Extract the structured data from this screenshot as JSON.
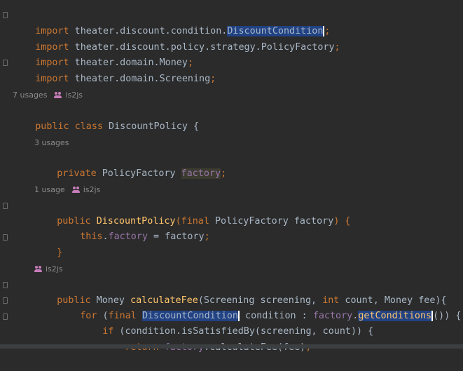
{
  "code": {
    "line1": {
      "kw": "import",
      "path": " theater.discount.condition.",
      "cls": "DiscountCondition",
      "semi": ";"
    },
    "line2": {
      "kw": "import",
      "rest": " theater.discount.policy.strategy.PolicyFactory",
      "semi": ";"
    },
    "line3": {
      "kw": "import",
      "rest": " theater.domain.Money",
      "semi": ";"
    },
    "line4": {
      "kw": "import",
      "rest": " theater.domain.Screening",
      "semi": ";"
    },
    "hint_class": {
      "usages": "7 usages",
      "author": "is2js"
    },
    "class_decl": {
      "kw1": "public",
      "kw2": " class",
      "name": " DiscountPolicy {",
      "tail": ""
    },
    "hint_field": {
      "usages": "3 usages"
    },
    "field_decl": {
      "kw": "private",
      "type": " PolicyFactory ",
      "name": "factory",
      "semi": ";"
    },
    "hint_ctor": {
      "usages": "1 usage",
      "author": "is2js"
    },
    "ctor_decl": {
      "kw": "public",
      "name": "DiscountPolicy",
      "open": "(",
      "kw2": "final",
      "params": " PolicyFactory factory",
      "close": ") {"
    },
    "ctor_body": {
      "kw": "this",
      "dot": ".",
      "fld": "factory",
      "rest": " = factory",
      "semi": ";"
    },
    "ctor_close": "}",
    "hint_method": {
      "author": "is2js"
    },
    "method_decl": {
      "kw": "public",
      "p1": " Money ",
      "name": "calculateFee",
      "p2": "(Screening screening, ",
      "kw2": "int",
      "p3": " count, Money fee){"
    },
    "for_line": {
      "kw": "for",
      "p1": " (",
      "kw2": "final",
      "p2": " ",
      "cls": "DiscountCondition",
      "p3": " condition : ",
      "fld": "factory",
      "dot": ".",
      "call": "getConditions",
      "p4": "()) {"
    },
    "if_line": {
      "kw": "if",
      "rest": " (condition.isSatisfiedBy(screening, count)) {"
    },
    "return_line": {
      "kw": "return",
      "p1": " ",
      "fld": "factory",
      "p2": ".calculateFee(fee)",
      "semi": ";"
    }
  }
}
